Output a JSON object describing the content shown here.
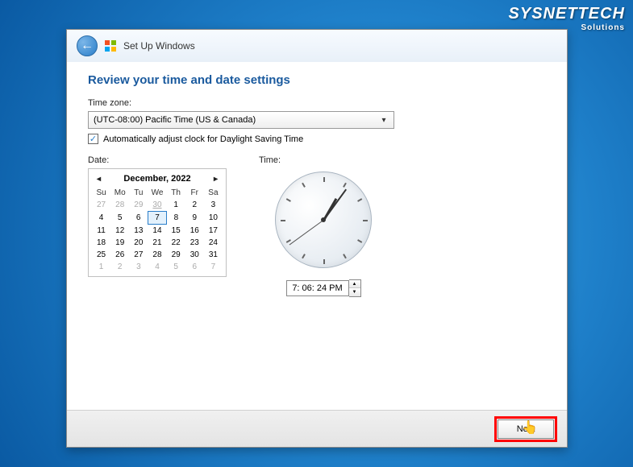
{
  "watermark": {
    "title": "SYSNETTECH",
    "subtitle": "Solutions"
  },
  "header": {
    "title": "Set Up Windows"
  },
  "heading": "Review your time and date settings",
  "timezone": {
    "label": "Time zone:",
    "selected": "(UTC-08:00) Pacific Time (US & Canada)"
  },
  "dst": {
    "checked": true,
    "label": "Automatically adjust clock for Daylight Saving Time"
  },
  "date": {
    "label": "Date:",
    "month": "December, 2022",
    "weekdays": [
      "Su",
      "Mo",
      "Tu",
      "We",
      "Th",
      "Fr",
      "Sa"
    ],
    "grid": [
      [
        {
          "n": 27,
          "dim": true
        },
        {
          "n": 28,
          "dim": true
        },
        {
          "n": 29,
          "dim": true
        },
        {
          "n": 30,
          "dim": true,
          "ul": true
        },
        {
          "n": 1
        },
        {
          "n": 2
        },
        {
          "n": 3
        }
      ],
      [
        {
          "n": 4
        },
        {
          "n": 5
        },
        {
          "n": 6
        },
        {
          "n": 7,
          "today": true
        },
        {
          "n": 8
        },
        {
          "n": 9
        },
        {
          "n": 10
        }
      ],
      [
        {
          "n": 11
        },
        {
          "n": 12
        },
        {
          "n": 13
        },
        {
          "n": 14
        },
        {
          "n": 15
        },
        {
          "n": 16
        },
        {
          "n": 17
        }
      ],
      [
        {
          "n": 18
        },
        {
          "n": 19
        },
        {
          "n": 20
        },
        {
          "n": 21
        },
        {
          "n": 22
        },
        {
          "n": 23
        },
        {
          "n": 24
        }
      ],
      [
        {
          "n": 25
        },
        {
          "n": 26
        },
        {
          "n": 27
        },
        {
          "n": 28
        },
        {
          "n": 29
        },
        {
          "n": 30
        },
        {
          "n": 31
        }
      ],
      [
        {
          "n": 1,
          "dim": true
        },
        {
          "n": 2,
          "dim": true
        },
        {
          "n": 3,
          "dim": true
        },
        {
          "n": 4,
          "dim": true
        },
        {
          "n": 5,
          "dim": true
        },
        {
          "n": 6,
          "dim": true
        },
        {
          "n": 7,
          "dim": true
        }
      ]
    ]
  },
  "time": {
    "label": "Time:",
    "value": "7: 06: 24 PM"
  },
  "footer": {
    "next": "Next"
  }
}
